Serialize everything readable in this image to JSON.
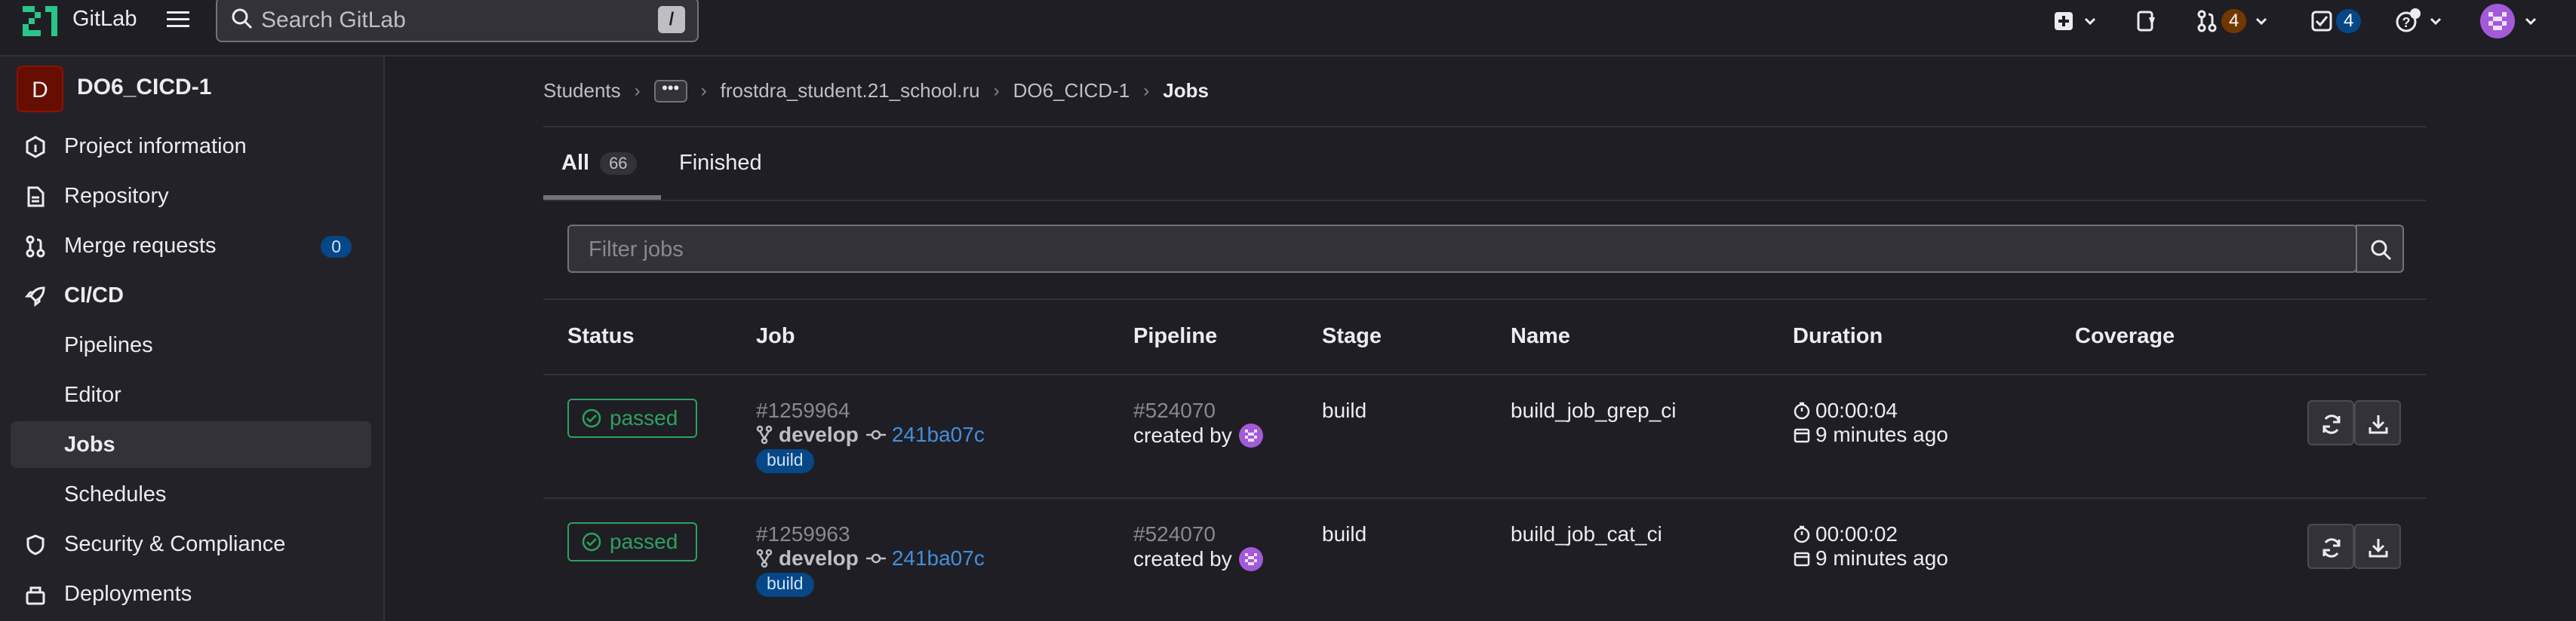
{
  "topbar": {
    "brand": "GitLab",
    "search_placeholder": "Search GitLab",
    "search_shortcut": "/",
    "merge_requests_count": "4",
    "todos_count": "4"
  },
  "sidebar": {
    "project_initial": "D",
    "project_name": "DO6_CICD-1",
    "items": [
      {
        "label": "Project information",
        "icon": "info-icon"
      },
      {
        "label": "Repository",
        "icon": "document-icon"
      },
      {
        "label": "Merge requests",
        "icon": "merge-request-icon",
        "count": "0"
      },
      {
        "label": "CI/CD",
        "icon": "rocket-icon"
      },
      {
        "label": "Pipelines"
      },
      {
        "label": "Editor"
      },
      {
        "label": "Jobs",
        "active": true
      },
      {
        "label": "Schedules"
      },
      {
        "label": "Security & Compliance",
        "icon": "shield-icon"
      },
      {
        "label": "Deployments",
        "icon": "deployments-icon"
      }
    ]
  },
  "breadcrumb": {
    "items": [
      "Students",
      "frostdra_student.21_school.ru",
      "DO6_CICD-1",
      "Jobs"
    ]
  },
  "tabs": {
    "all_label": "All",
    "all_count": "66",
    "finished_label": "Finished"
  },
  "filter": {
    "placeholder": "Filter jobs"
  },
  "table": {
    "headers": [
      "Status",
      "Job",
      "Pipeline",
      "Stage",
      "Name",
      "Duration",
      "Coverage"
    ],
    "rows": [
      {
        "status": "passed",
        "job_id": "#1259964",
        "ref": "develop",
        "commit": "241ba07c",
        "stage_badge": "build",
        "pipeline_id": "#524070",
        "created_by": "created by",
        "stage": "build",
        "name": "build_job_grep_ci",
        "duration": "00:00:04",
        "finished": "9 minutes ago"
      },
      {
        "status": "passed",
        "job_id": "#1259963",
        "ref": "develop",
        "commit": "241ba07c",
        "stage_badge": "build",
        "pipeline_id": "#524070",
        "created_by": "created by",
        "stage": "build",
        "name": "build_job_cat_ci",
        "duration": "00:00:02",
        "finished": "9 minutes ago"
      }
    ]
  },
  "colors": {
    "background": "#1f1e24",
    "sidebar": "#232228",
    "success": "#2da160",
    "link": "#428fdc",
    "badge_blue": "#064787",
    "badge_orange": "#703800",
    "avatar_purple": "#a35ad8"
  }
}
